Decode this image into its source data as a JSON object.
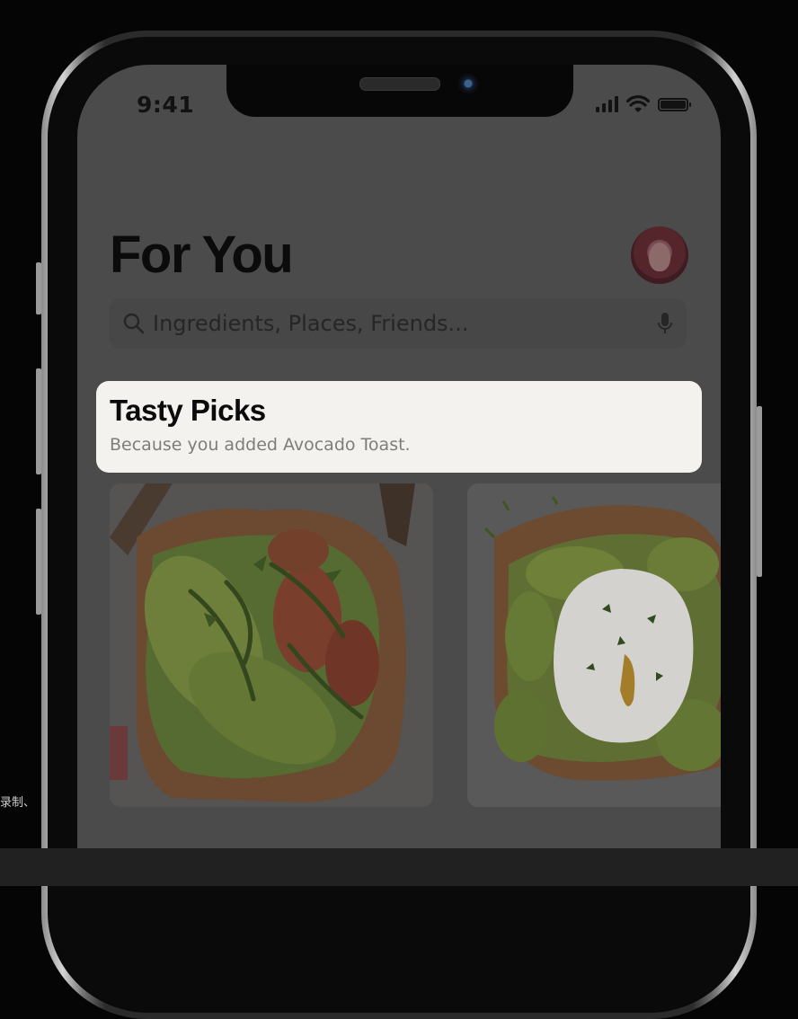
{
  "status_bar": {
    "time": "9:41"
  },
  "header": {
    "title": "For You"
  },
  "search": {
    "placeholder": "Ingredients, Places, Friends..."
  },
  "section": {
    "title": "Tasty Picks",
    "subtitle": "Because you added Avocado Toast."
  },
  "caption": "录制、",
  "colors": {
    "dim_background": "#4b4b4b",
    "highlight_card": "#f3f2ee",
    "title_text": "#0b0b0b",
    "subtitle_text": "#7d7d7b"
  },
  "icons": {
    "search": "search-icon",
    "mic": "microphone-icon",
    "signal": "cellular-signal-icon",
    "wifi": "wifi-icon",
    "battery": "battery-icon",
    "avatar": "memoji-avatar"
  }
}
